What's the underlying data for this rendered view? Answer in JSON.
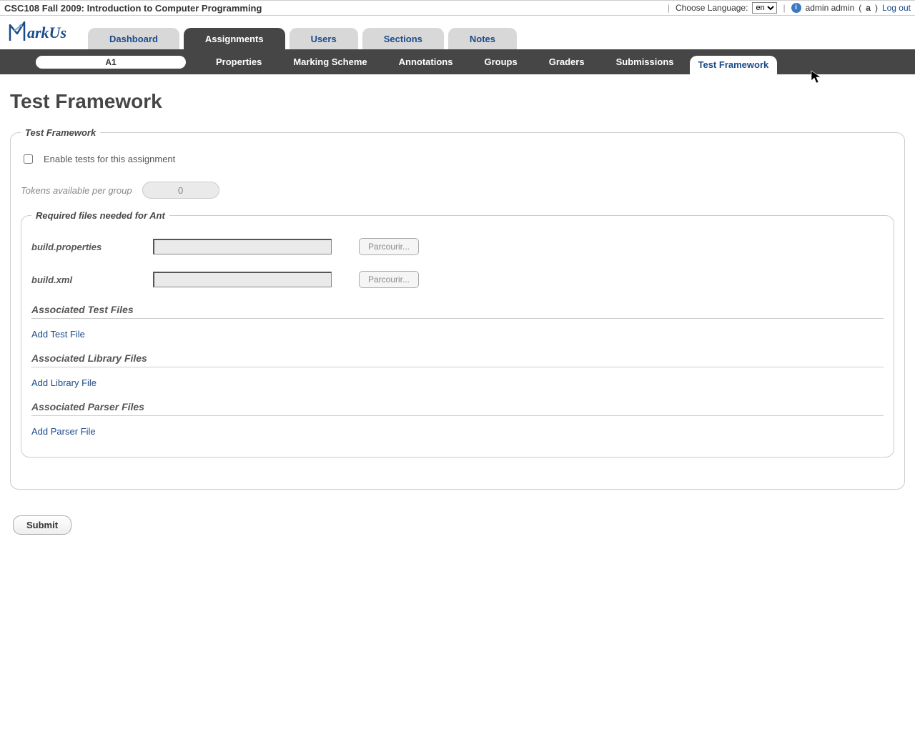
{
  "topbar": {
    "course_title": "CSC108 Fall 2009: Introduction to Computer Programming",
    "choose_language_label": "Choose Language:",
    "language_value": "en",
    "user_display": "admin admin",
    "role_short": "a",
    "logout_label": "Log out"
  },
  "logo_text": "arkUs",
  "primary_tabs": [
    {
      "label": "Dashboard",
      "active": false
    },
    {
      "label": "Assignments",
      "active": true
    },
    {
      "label": "Users",
      "active": false
    },
    {
      "label": "Sections",
      "active": false
    },
    {
      "label": "Notes",
      "active": false
    }
  ],
  "assignment_pill": "A1",
  "secondary_tabs": [
    {
      "label": "Properties",
      "active": false
    },
    {
      "label": "Marking Scheme",
      "active": false
    },
    {
      "label": "Annotations",
      "active": false
    },
    {
      "label": "Groups",
      "active": false
    },
    {
      "label": "Graders",
      "active": false
    },
    {
      "label": "Submissions",
      "active": false
    },
    {
      "label": "Test Framework",
      "active": true
    }
  ],
  "page_title": "Test Framework",
  "outer_legend": "Test Framework",
  "enable_label": "Enable tests for this assignment",
  "tokens_label": "Tokens available per group",
  "tokens_value": "0",
  "required_legend": "Required files needed for Ant",
  "files": {
    "build_properties_label": "build.properties",
    "build_xml_label": "build.xml",
    "browse_label": "Parcourir..."
  },
  "sections": {
    "test_files_header": "Associated Test Files",
    "add_test_file": "Add Test File",
    "library_files_header": "Associated Library Files",
    "add_library_file": "Add Library File",
    "parser_files_header": "Associated Parser Files",
    "add_parser_file": "Add Parser File"
  },
  "submit_label": "Submit"
}
